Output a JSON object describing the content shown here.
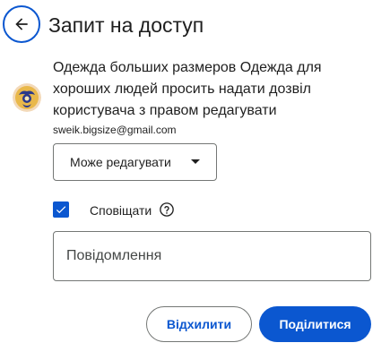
{
  "header": {
    "back_icon": "arrow-back-icon",
    "title": "Запит на доступ"
  },
  "request": {
    "avatar_icon": "user-avatar",
    "text": "Одежда больших размеров Одежда для хороших людей просить надати дозвіл користувача з правом редагувати",
    "email": "sweik.bigsize@gmail.com"
  },
  "role": {
    "selected": "Може редагувати",
    "caret_icon": "dropdown-caret-icon"
  },
  "notify": {
    "checked": true,
    "label": "Сповіщати",
    "help_icon": "help-icon"
  },
  "message": {
    "placeholder": "Повідомлення",
    "value": ""
  },
  "actions": {
    "decline_label": "Відхилити",
    "share_label": "Поділитися"
  },
  "colors": {
    "accent": "#0b57d0",
    "text": "#1f1f1f",
    "outline": "#747775"
  }
}
